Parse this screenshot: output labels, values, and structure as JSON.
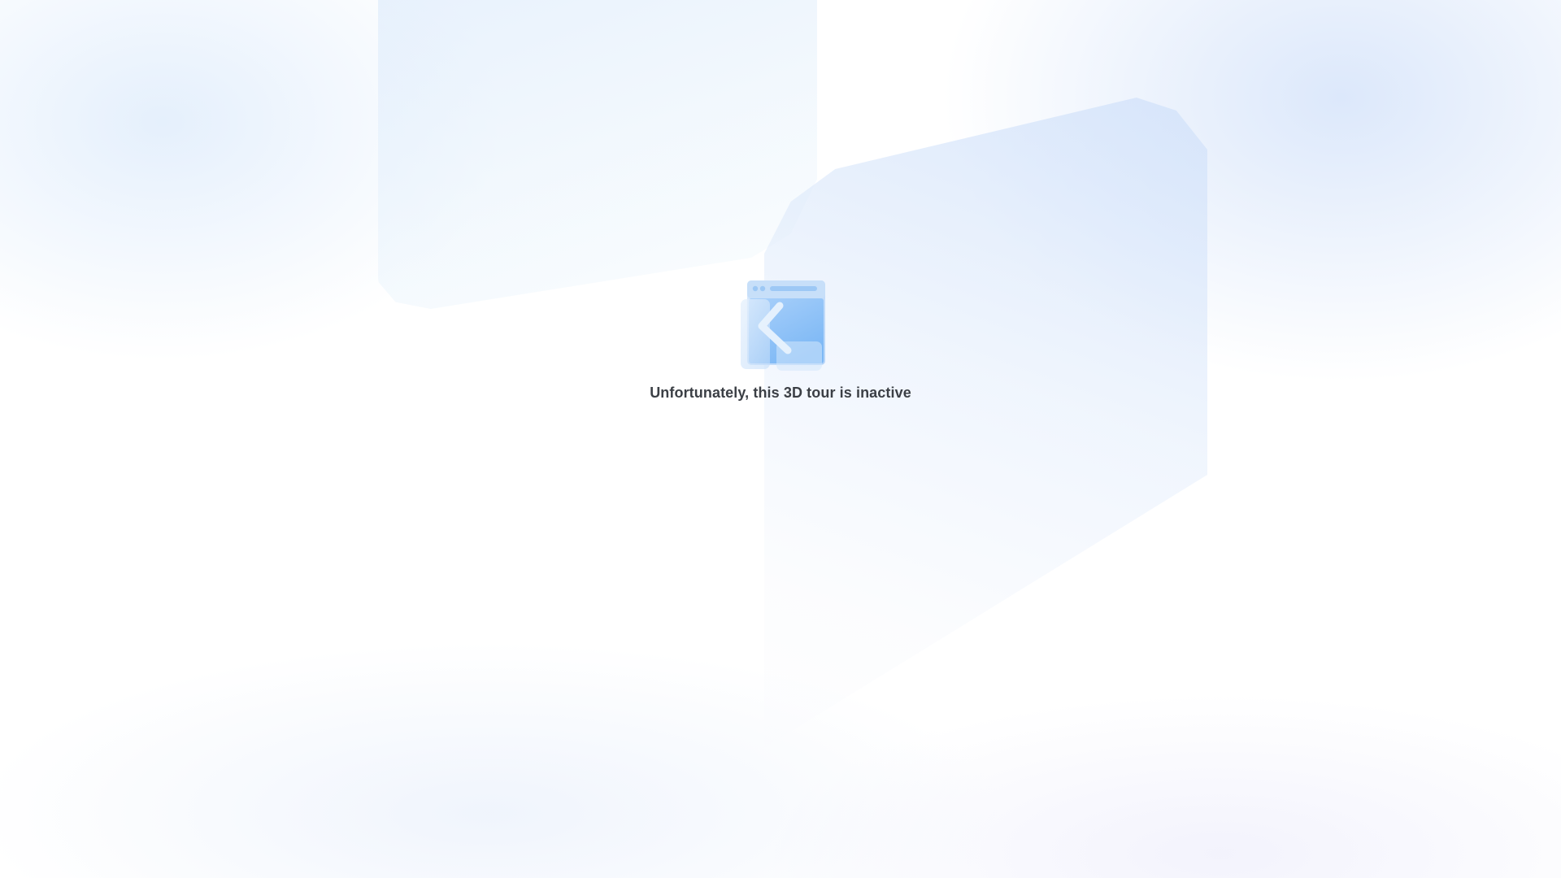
{
  "icon": {
    "name": "inactive-tour-browser-icon",
    "colors": {
      "window_back": "#bcd8f9",
      "window_front": "#8ec2f7",
      "chevron": "#e8f2fd"
    }
  },
  "message": {
    "text": "Unfortunately, this 3D tour is inactive",
    "color": "#3b3f45"
  },
  "background": {
    "base": "#ffffff",
    "accent": "#d6e4fa"
  }
}
